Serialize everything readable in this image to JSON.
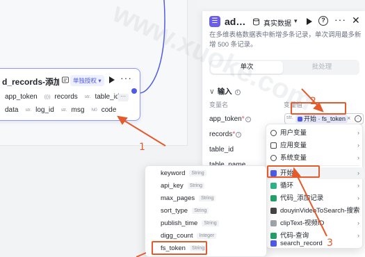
{
  "node": {
    "title": "d_records-添加…",
    "badge": "单独授权 ▾",
    "row1": [
      {
        "type": "",
        "name": "app_token"
      },
      {
        "type": "{{}}",
        "name": "records"
      },
      {
        "type": "str.",
        "name": "table_id"
      }
    ],
    "row2": [
      {
        "type": "",
        "name": "data"
      },
      {
        "type": "str.",
        "name": "log_id"
      },
      {
        "type": "str.",
        "name": "msg"
      },
      {
        "type": "N0",
        "name": "code"
      }
    ],
    "more": "···"
  },
  "panel": {
    "logo": "",
    "title": "ad…",
    "data_label": "真实数据",
    "description": "在多维表格数据表中新增多条记录，单次调用最多新增 500 条记录。",
    "tabs": [
      "单次",
      "批处理"
    ],
    "section": "输入",
    "col_name": "变量名",
    "col_value": "变量值",
    "vars": [
      {
        "name": "app_token",
        "required": true
      },
      {
        "name": "records",
        "required": true
      },
      {
        "name": "table_id",
        "required": false
      },
      {
        "name": "table_name",
        "required": false
      }
    ],
    "ref_type": "str.",
    "ref_value": "开始 · fs_token"
  },
  "menu": [
    {
      "label": "用户变量",
      "icon": "user-icon"
    },
    {
      "label": "应用变量",
      "icon": "folder-icon"
    },
    {
      "label": "系统变量",
      "icon": "gear-icon"
    },
    {
      "label": "开始",
      "icon": "start-icon"
    },
    {
      "label": "循环",
      "icon": "loop-icon"
    },
    {
      "label": "代码_添加记录",
      "icon": "code-icon"
    },
    {
      "label": "douyinVideoToSearch-搜索",
      "icon": "douyin-icon"
    },
    {
      "label": "clipText-视频ID",
      "icon": "clip-icon"
    },
    {
      "label": "代码-查询",
      "icon": "code-icon"
    },
    {
      "label": "search_record",
      "icon": "search-icon"
    }
  ],
  "submenu": [
    {
      "name": "keyword",
      "type": "String"
    },
    {
      "name": "api_key",
      "type": "String"
    },
    {
      "name": "max_pages",
      "type": "String"
    },
    {
      "name": "sort_type",
      "type": "String"
    },
    {
      "name": "publish_time",
      "type": "String"
    },
    {
      "name": "digg_count",
      "type": "Integer"
    },
    {
      "name": "fs_token",
      "type": "String"
    }
  ],
  "annotations": [
    "1",
    "2",
    "3"
  ],
  "watermark": "www.xuoke.com",
  "colors": {
    "accent": "#4e5ae8",
    "annotation": "#e55a2b"
  }
}
